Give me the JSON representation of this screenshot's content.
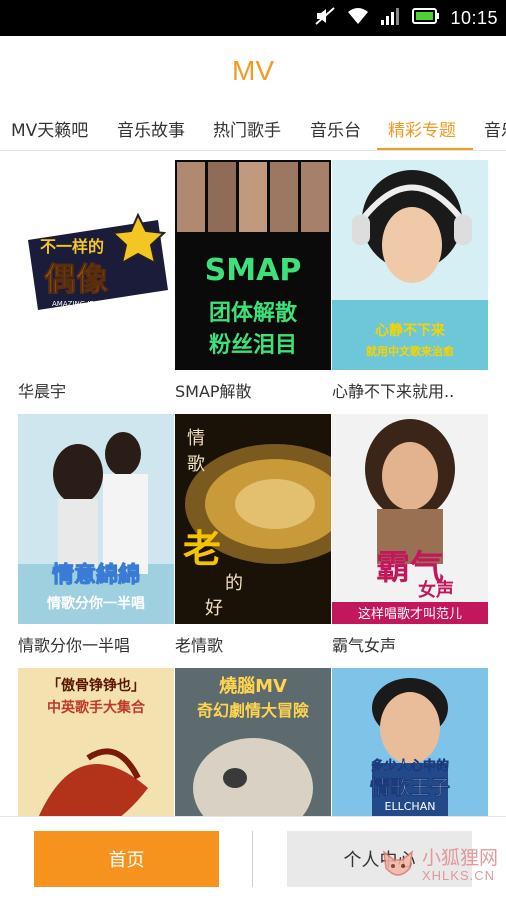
{
  "status_bar": {
    "time": "10:15",
    "icons": [
      "mute-icon",
      "wifi-icon",
      "signal-icon",
      "battery-icon"
    ]
  },
  "header": {
    "title": "MV"
  },
  "tabs": [
    {
      "label": "MV天籁吧",
      "active": false
    },
    {
      "label": "音乐故事",
      "active": false
    },
    {
      "label": "热门歌手",
      "active": false
    },
    {
      "label": "音乐台",
      "active": false
    },
    {
      "label": "精彩专题",
      "active": true
    },
    {
      "label": "音乐",
      "active": false
    }
  ],
  "grid": {
    "items": [
      {
        "caption": "华晨宇",
        "overlay": [
          "不一样的",
          "偶像"
        ],
        "overlay_small": "AMAZING IDOL"
      },
      {
        "caption": "SMAP解散",
        "overlay": [
          "SMAP",
          "团体解散",
          "粉丝泪目"
        ]
      },
      {
        "caption": "心静不下来就用..",
        "overlay": [
          "心静不下来",
          "就用中文歌来治愈"
        ]
      },
      {
        "caption": "情歌分你一半唱",
        "overlay": [
          "情意綿綿",
          "情歌分你一半唱"
        ]
      },
      {
        "caption": "老情歌",
        "overlay": [
          "情",
          "歌",
          "老",
          "的",
          "好"
        ]
      },
      {
        "caption": "霸气女声",
        "overlay": [
          "霸气",
          "女声",
          "这样唱歌才叫范儿"
        ]
      },
      {
        "caption": "",
        "overlay": [
          "「傲骨铮铮也」",
          "中英歌手大集合"
        ]
      },
      {
        "caption": "",
        "overlay": [
          "燒腦MV",
          "奇幻劇情大冒險"
        ]
      },
      {
        "caption": "",
        "overlay": [
          "多少人心中的",
          "情歌王子",
          "ELLCHAN"
        ]
      }
    ]
  },
  "bottom_nav": {
    "home_label": "首页",
    "profile_label": "个人中心"
  },
  "watermark": {
    "cn": "小狐狸网",
    "en": "XHLKS.CN"
  },
  "colors": {
    "accent": "#f29b22",
    "home_button": "#f6931e"
  }
}
